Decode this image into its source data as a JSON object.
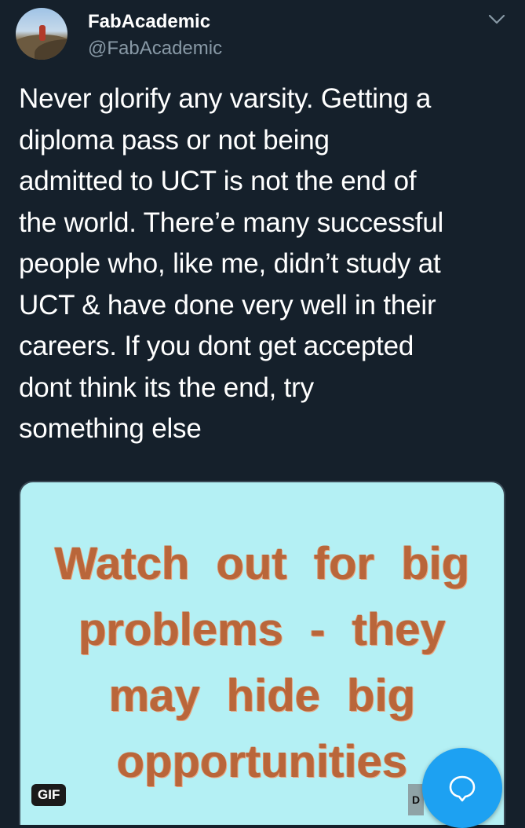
{
  "tweet": {
    "author_name": "FabAcademic",
    "author_handle": "@FabAcademic",
    "text": "Never glorify any varsity. Getting a\ndiploma pass or not being\nadmitted to UCT is not the end of\nthe world. There’e many successful\npeople who, like me, didn’t study at\nUCT & have done very well in their\ncareers. If you dont get accepted\ndont think its the end, try\nsomething else"
  },
  "media": {
    "gif_text": "Watch out for big\nproblems - they\nmay hide big\nopportunities",
    "badge": "GIF",
    "corner_mark": "D"
  },
  "icons": {
    "menu": "chevron-down-icon",
    "compose": "reply-bubble-icon"
  },
  "colors": {
    "background": "#15202b",
    "accent": "#1da1f2",
    "gif_background": "#b4f0f4",
    "gif_text": "#b9663a"
  }
}
